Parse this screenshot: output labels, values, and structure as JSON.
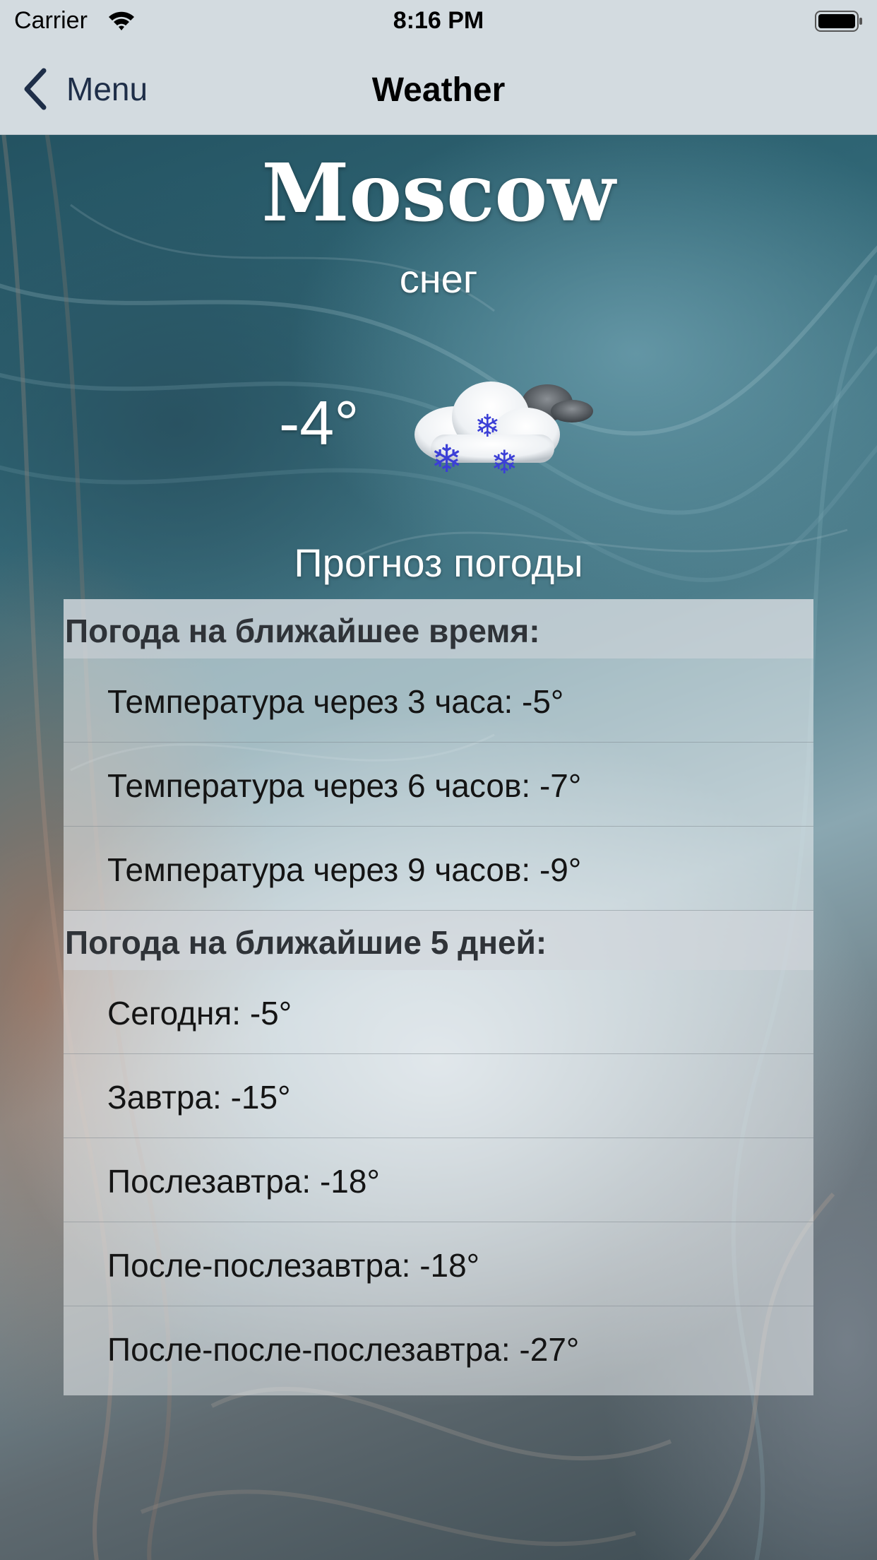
{
  "status_bar": {
    "carrier": "Carrier",
    "time": "8:16 PM"
  },
  "nav": {
    "back_label": "Menu",
    "title": "Weather"
  },
  "weather": {
    "city": "Moscow",
    "condition": "снег",
    "current_temp": "-4°",
    "icon": "snow-cloud-icon",
    "forecast_title": "Прогноз погоды"
  },
  "sections": [
    {
      "header": "Погода на ближайшее время:",
      "rows": [
        "Температура через 3 часа: -5°",
        "Температура через 6 часов: -7°",
        "Температура через 9 часов: -9°"
      ]
    },
    {
      "header": "Погода на ближайшие 5 дней:",
      "rows": [
        "Сегодня: -5°",
        "Завтра: -15°",
        "Послезавтра: -18°",
        "После-послезавтра: -18°",
        "После-после-послезавтра: -27°"
      ]
    }
  ],
  "colors": {
    "nav_background": "#d3dbe0",
    "back_tint": "#1e2e48",
    "snowflake": "#3b3fd6"
  }
}
